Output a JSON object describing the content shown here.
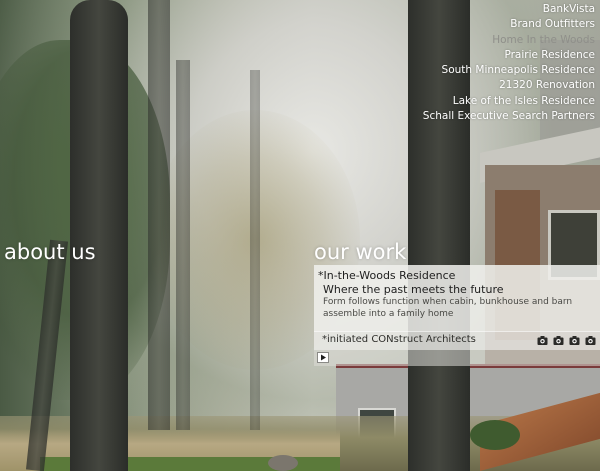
{
  "nav": {
    "projects": [
      {
        "label": "BankVista",
        "active": false
      },
      {
        "label": "Brand Outfitters",
        "active": false
      },
      {
        "label": "Home In the Woods",
        "active": true
      },
      {
        "label": "Prairie Residence",
        "active": false
      },
      {
        "label": "South Minneapolis Residence",
        "active": false
      },
      {
        "label": "21320 Renovation",
        "active": false
      },
      {
        "label": "Lake of the Isles Residence",
        "active": false
      },
      {
        "label": "Schall Executive Search Partners",
        "active": false
      }
    ]
  },
  "sections": {
    "about": "about us",
    "work": "our work"
  },
  "panel": {
    "project_name": "*In-the-Woods Residence",
    "tagline": "Where the past meets the future",
    "description": "Form follows function when cabin, bunkhouse and barn assemble into a family home",
    "credit": "*initiated CONstruct Architects",
    "camera_icons": [
      "camera-icon",
      "camera-icon",
      "camera-icon",
      "camera-icon"
    ],
    "play_icon": "play-icon"
  },
  "colors": {
    "nav_text": "#ffffff",
    "nav_active": "#8f8f8a",
    "panel_bg": "#f0f0ec"
  }
}
